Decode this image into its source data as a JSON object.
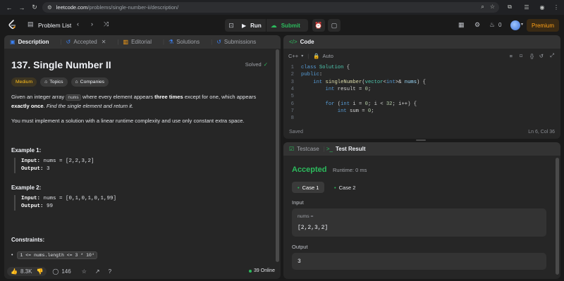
{
  "browser": {
    "url_host": "leetcode.com",
    "url_path": "/problems/single-number-ii/description/"
  },
  "topbar": {
    "problem_list": "Problem List",
    "run": "Run",
    "submit": "Submit",
    "fire_count": "0",
    "premium": "Premium"
  },
  "left_tabs": {
    "description": "Description",
    "accepted": "Accepted",
    "editorial": "Editorial",
    "solutions": "Solutions",
    "submissions": "Submissions"
  },
  "problem": {
    "title": "137. Single Number II",
    "solved": "Solved",
    "difficulty": "Medium",
    "topics": "Topics",
    "companies": "Companies",
    "p1_a": "Given an integer array",
    "p1_code": "nums",
    "p1_b": "where every element appears",
    "p1_bold1": "three times",
    "p1_c": "except for one, which appears",
    "p1_bold2": "exactly once",
    "p1_d": ".",
    "p1_italic": "Find the single element and return it.",
    "p2": "You must implement a solution with a linear runtime complexity and use only constant extra space.",
    "example1_title": "Example 1:",
    "ex1_input_label": "Input:",
    "ex1_input": "nums = [2,2,3,2]",
    "ex1_output_label": "Output:",
    "ex1_output": "3",
    "example2_title": "Example 2:",
    "ex2_input_label": "Input:",
    "ex2_input": "nums = [0,1,0,1,0,1,99]",
    "ex2_output_label": "Output:",
    "ex2_output": "99",
    "constraints_title": "Constraints:",
    "constraint1": "1 <= nums.length <= 3 * 10⁴"
  },
  "left_footer": {
    "likes": "8.3K",
    "comments": "146",
    "online": "39 Online"
  },
  "code_panel": {
    "title": "Code",
    "language": "C++",
    "auto": "Auto",
    "saved": "Saved",
    "cursor": "Ln 6, Col 36",
    "line_numbers": [
      "1",
      "2",
      "3",
      "4",
      "5",
      "6",
      "7",
      "8"
    ]
  },
  "result_panel": {
    "testcase_tab": "Testcase",
    "result_tab": "Test Result",
    "status": "Accepted",
    "runtime": "Runtime: 0 ms",
    "case1": "Case 1",
    "case2": "Case 2",
    "input_label": "Input",
    "var_name": "nums =",
    "var_value": "[2,2,3,2]",
    "output_label": "Output",
    "output_value": "3"
  },
  "colors": {
    "accepted": "#2cbb5d",
    "medium": "#ffc01e",
    "submit": "#2cbb5d",
    "premium": "#ffa116"
  }
}
